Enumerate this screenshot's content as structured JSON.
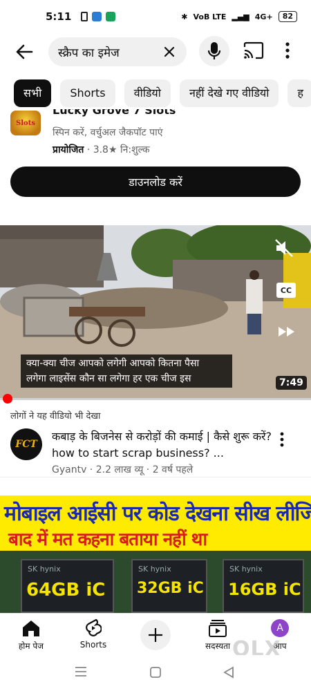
{
  "status_bar": {
    "time": "5:11",
    "network": "VoB LTE",
    "signal": "4G+",
    "battery": "82"
  },
  "search": {
    "query": "स्क्रैप का इमेज"
  },
  "chips": [
    "सभी",
    "Shorts",
    "वीडियो",
    "नहीं देखे गए वीडियो",
    "ह"
  ],
  "ad": {
    "logo_text": "Slots",
    "title": "Lucky Grove 7 Slots",
    "subtitle": "स्पिन करें, वर्चुअल जैकपॉट पाएं",
    "sponsored": "प्रायोजित",
    "rating": "3.8★",
    "price": "नि:शुल्क",
    "button": "डाउनलोड करें"
  },
  "video": {
    "caption_line1": "क्या-क्या चीज आपको लगेगी आपको कितना पैसा",
    "caption_line2": "लगेगा लाइसेंस कौन सा लगेगा हर एक चीज इस",
    "duration": "7:49",
    "cc": "CC",
    "progress": 0.02
  },
  "related": {
    "label": "लोगों ने यह वीडियो भी देखा",
    "channel_avatar_text": "FCT",
    "title": "कबाड़ के बिजनेस से करोड़ों की कमाई | कैसे शुरू करें? how to start scrap business? ...",
    "meta": "Gyantv · 2.2 लाख व्यू · 2 वर्ष पहले"
  },
  "thumbnail2": {
    "line1": "मोबाइल आईसी पर कोड देखना सीख लीजिए",
    "line2": "बाद में मत कहना बताया नहीं था",
    "chips": [
      {
        "brand": "SK hynix",
        "label": "64GB iC"
      },
      {
        "brand": "SK hynix",
        "label": "32GB iC"
      },
      {
        "brand": "SK hynix",
        "label": "16GB iC"
      }
    ]
  },
  "bottom_nav": {
    "home": "होम पेज",
    "shorts": "Shorts",
    "subscriptions": "सदस्यता",
    "you": "आप",
    "avatar_letter": "A"
  },
  "watermark": "OLX",
  "colors": {
    "accent": "#ff0000",
    "chip_active": "#0f0f0f",
    "avatar": "#8e44c9"
  }
}
